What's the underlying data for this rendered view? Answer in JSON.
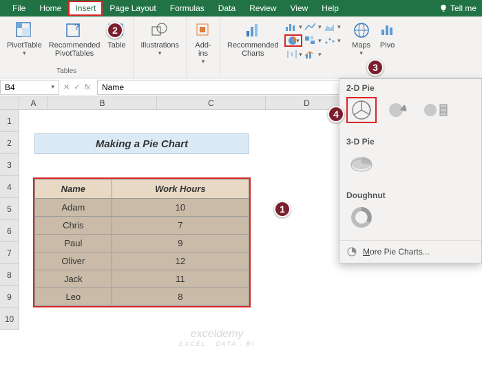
{
  "tabs": [
    "File",
    "Home",
    "Insert",
    "Page Layout",
    "Formulas",
    "Data",
    "Review",
    "View",
    "Help"
  ],
  "tellme": "Tell me",
  "ribbon": {
    "pivottable": "PivotTable",
    "recpivot": "Recommended\nPivotTables",
    "table": "Table",
    "tables_group": "Tables",
    "illustrations": "Illustrations",
    "addins": "Add-\nins",
    "reccharts": "Recommended\nCharts",
    "maps": "Maps",
    "pivotchart": "Pivo"
  },
  "namebox": "B4",
  "formula": "Name",
  "cols": [
    "A",
    "B",
    "C",
    "D"
  ],
  "rownums": [
    "1",
    "2",
    "3",
    "4",
    "5",
    "6",
    "7",
    "8",
    "9",
    "10"
  ],
  "title": "Making a Pie Chart",
  "chart_data": {
    "type": "pie",
    "title": "Making a Pie Chart",
    "categories": [
      "Adam",
      "Chris",
      "Paul",
      "Oliver",
      "Jack",
      "Leo"
    ],
    "values": [
      10,
      7,
      9,
      12,
      11,
      8
    ],
    "headers": [
      "Name",
      "Work Hours"
    ]
  },
  "dropdown": {
    "s1": "2-D Pie",
    "s2": "3-D Pie",
    "s3": "Doughnut",
    "more": "More Pie Charts..."
  },
  "watermark": "exceldemy",
  "watermark_sub": "EXCEL · DATA · BI",
  "callouts": {
    "c1": "1",
    "c2": "2",
    "c3": "3",
    "c4": "4"
  }
}
